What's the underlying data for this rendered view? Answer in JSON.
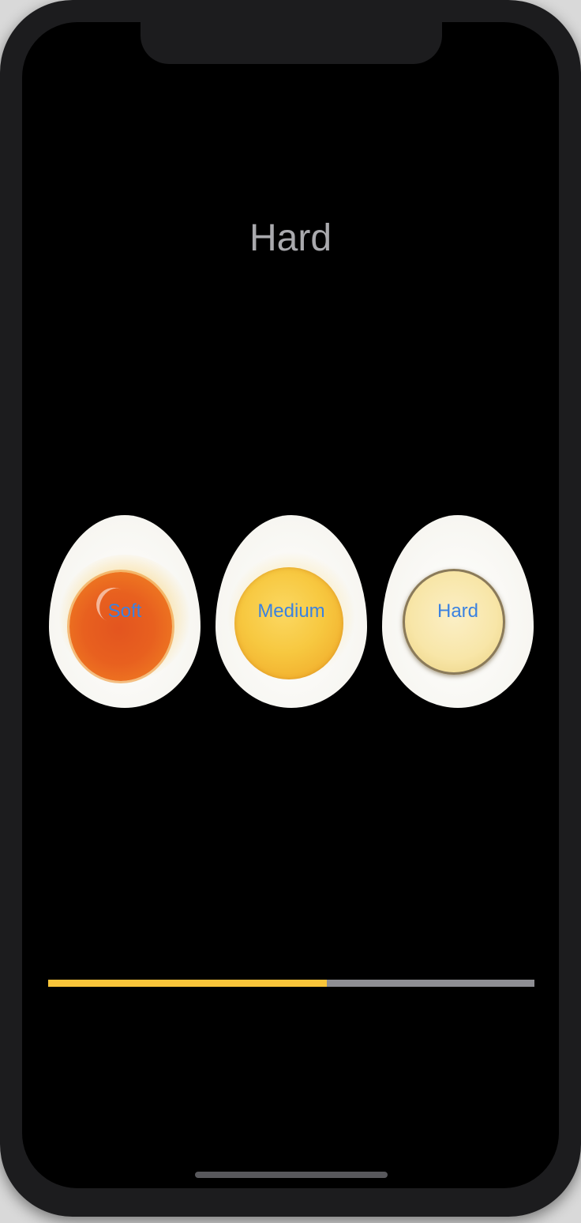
{
  "title": "Hard",
  "eggs": [
    {
      "label": "Soft",
      "style": "soft",
      "yolk_color": "#e8601f"
    },
    {
      "label": "Medium",
      "style": "medium",
      "yolk_color": "#f7c840"
    },
    {
      "label": "Hard",
      "style": "hard",
      "yolk_color": "#f8e6a8"
    }
  ],
  "progress": {
    "value": 0.573,
    "fill_color": "#f9c53a",
    "track_color": "#8e8e93"
  },
  "colors": {
    "background": "#000000",
    "title_text": "#a9a9ad",
    "button_text": "#3b82e0"
  }
}
